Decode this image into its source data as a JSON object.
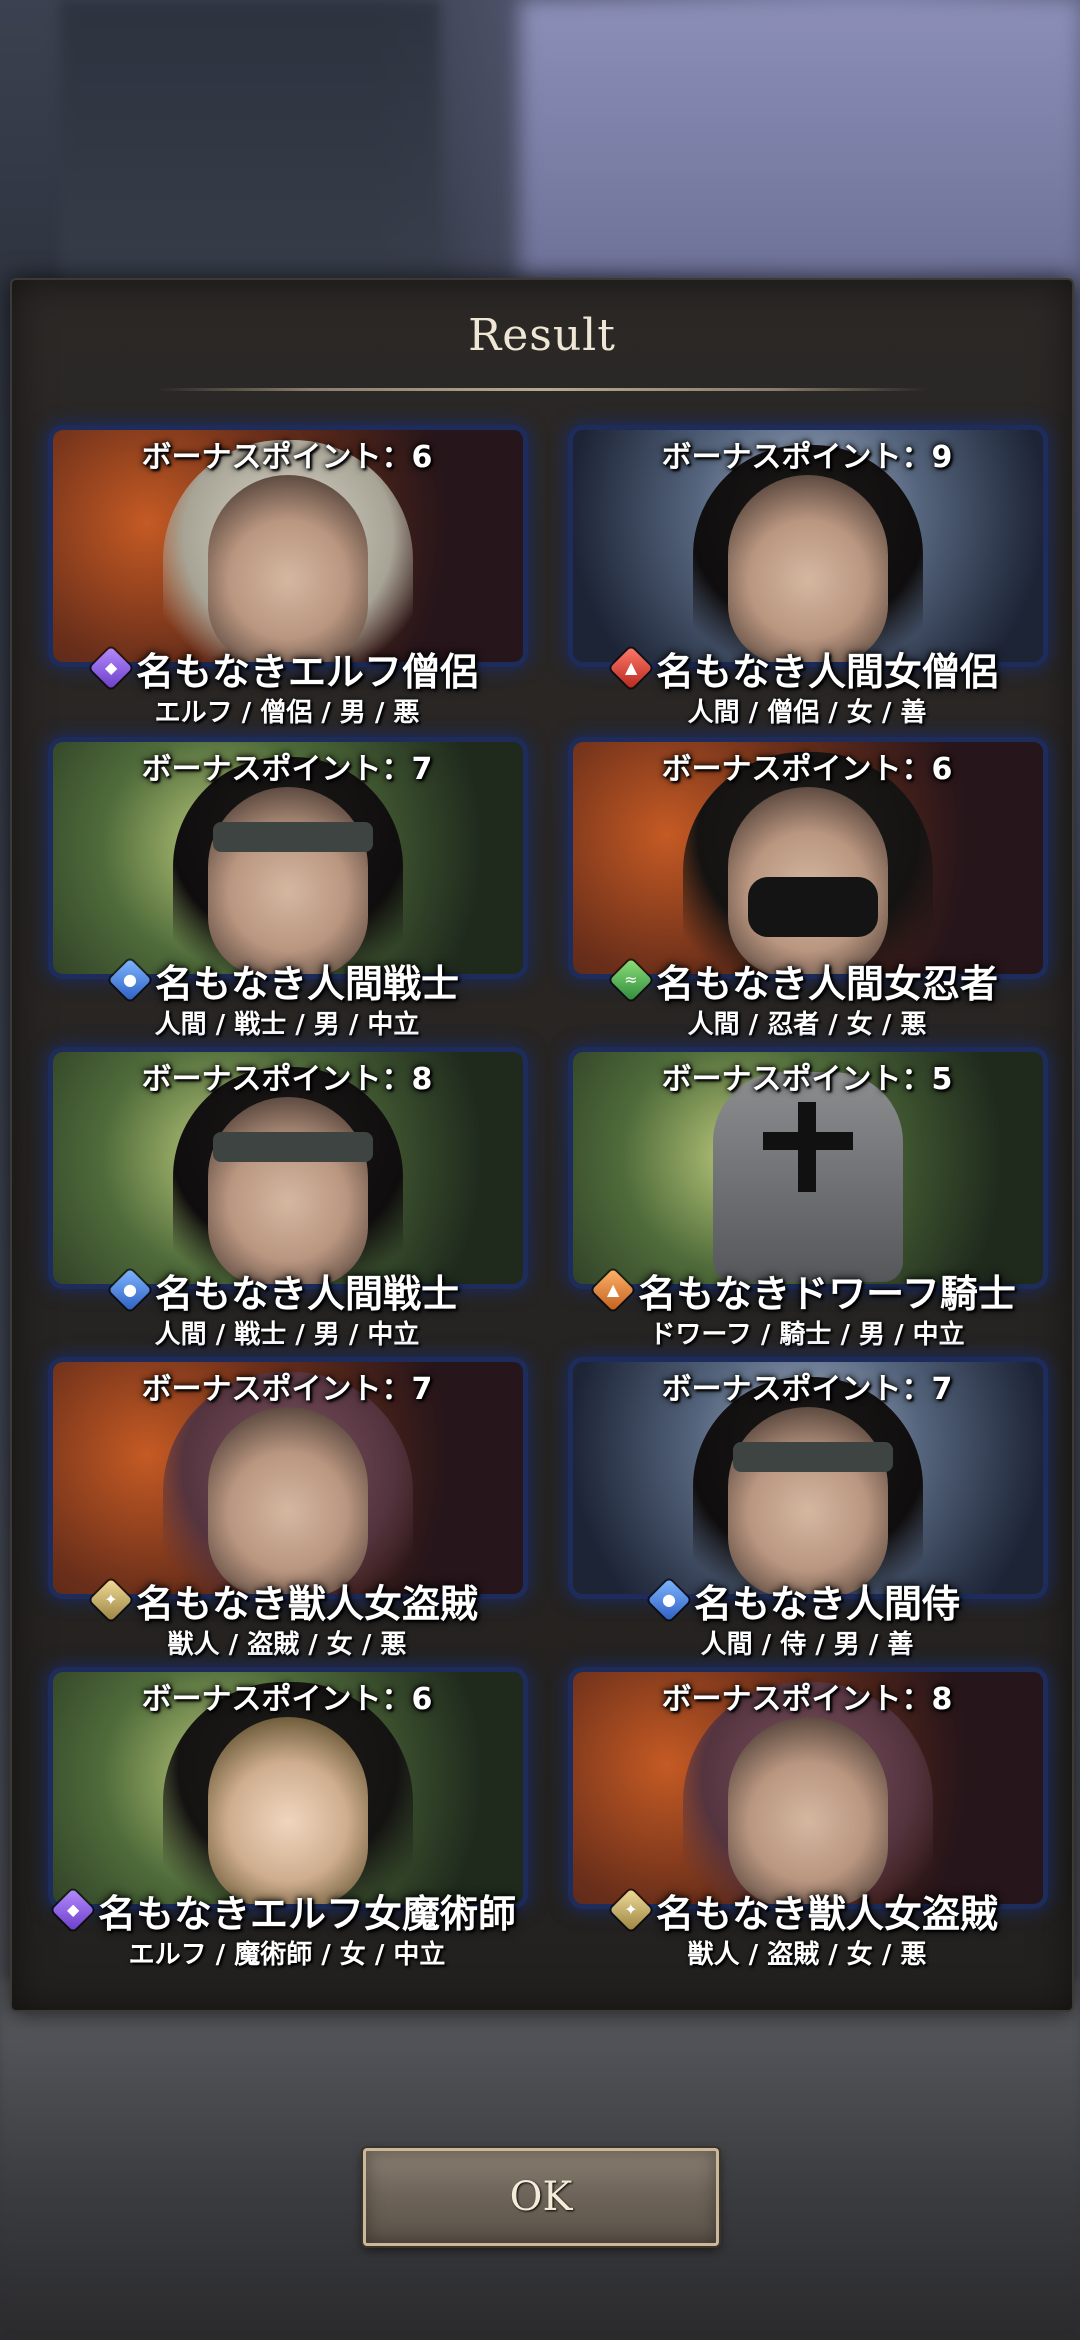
{
  "dialog": {
    "title": "Result",
    "ok_label": "OK"
  },
  "results": [
    {
      "bonus": "ボーナスポイント：6",
      "name": "名もなきエルフ僧侶",
      "attrs": "エルフ / 僧侶 / 男 / 悪",
      "element_icon": "purple-diamond-icon",
      "element_color": "#8a5be0"
    },
    {
      "bonus": "ボーナスポイント：9",
      "name": "名もなき人間女僧侶",
      "attrs": "人間 / 僧侶 / 女 / 善",
      "element_icon": "red-flame-icon",
      "element_color": "#d8382b"
    },
    {
      "bonus": "ボーナスポイント：7",
      "name": "名もなき人間戦士",
      "attrs": "人間 / 戦士 / 男 / 中立",
      "element_icon": "blue-water-icon",
      "element_color": "#3e78d8"
    },
    {
      "bonus": "ボーナスポイント：6",
      "name": "名もなき人間女忍者",
      "attrs": "人間 / 忍者 / 女 / 悪",
      "element_icon": "green-wind-icon",
      "element_color": "#3e9e48"
    },
    {
      "bonus": "ボーナスポイント：8",
      "name": "名もなき人間戦士",
      "attrs": "人間 / 戦士 / 男 / 中立",
      "element_icon": "blue-water-icon",
      "element_color": "#3e78d8"
    },
    {
      "bonus": "ボーナスポイント：5",
      "name": "名もなきドワーフ騎士",
      "attrs": "ドワーフ / 騎士 / 男 / 中立",
      "element_icon": "orange-earth-icon",
      "element_color": "#d07a2e"
    },
    {
      "bonus": "ボーナスポイント：7",
      "name": "名もなき獣人女盗賊",
      "attrs": "獣人 / 盗賊 / 女 / 悪",
      "element_icon": "gold-light-icon",
      "element_color": "#c4ab5e"
    },
    {
      "bonus": "ボーナスポイント：7",
      "name": "名もなき人間侍",
      "attrs": "人間 / 侍 / 男 / 善",
      "element_icon": "blue-water-icon",
      "element_color": "#3e78d8"
    },
    {
      "bonus": "ボーナスポイント：6",
      "name": "名もなきエルフ女魔術師",
      "attrs": "エルフ / 魔術師 / 女 / 中立",
      "element_icon": "purple-diamond-icon",
      "element_color": "#8a5be0"
    },
    {
      "bonus": "ボーナスポイント：8",
      "name": "名もなき獣人女盗賊",
      "attrs": "獣人 / 盗賊 / 女 / 悪",
      "element_icon": "gold-light-icon",
      "element_color": "#c4ab5e"
    }
  ]
}
